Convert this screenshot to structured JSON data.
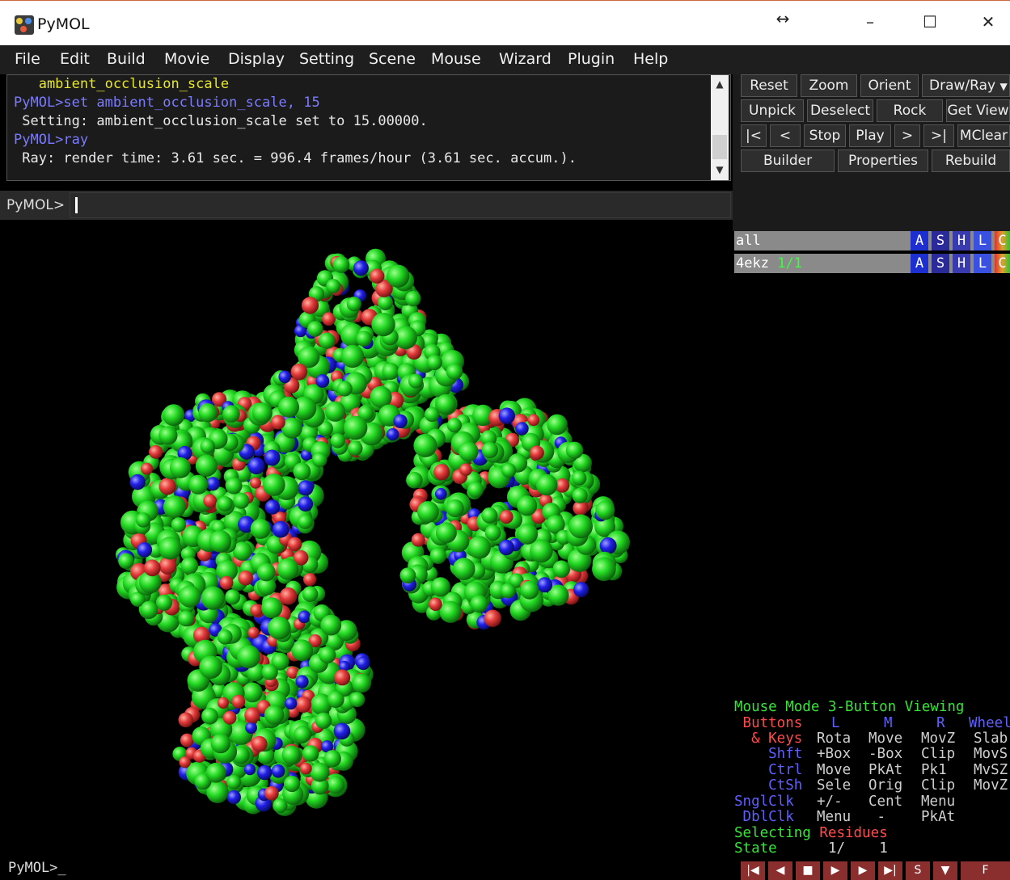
{
  "window": {
    "title": "PyMOL",
    "resize_icon": "↔",
    "minimize": "–",
    "maximize": "☐",
    "close": "✕"
  },
  "menu": [
    "File",
    "Edit",
    "Build",
    "Movie",
    "Display",
    "Setting",
    "Scene",
    "Mouse",
    "Wizard",
    "Plugin",
    "Help"
  ],
  "console": {
    "lines": [
      {
        "text": "   ambient_occlusion_scale",
        "color": "#e6e62e"
      },
      {
        "text": "PyMOL>set ambient_occlusion_scale, 15",
        "color": "#7b7bff"
      },
      {
        "text": " Setting: ambient_occlusion_scale set to 15.00000.",
        "color": "#e8e8e8"
      },
      {
        "text": "PyMOL>ray",
        "color": "#7b7bff"
      },
      {
        "text": " Ray: render time: 3.61 sec. = 996.4 frames/hour (3.61 sec. accum.).",
        "color": "#e8e8e8"
      }
    ]
  },
  "command": {
    "prompt": "PyMOL>",
    "value": ""
  },
  "buttons": {
    "row1": [
      "Reset",
      "Zoom",
      "Orient",
      "Draw/Ray"
    ],
    "row2": [
      "Unpick",
      "Deselect",
      "Rock",
      "Get View"
    ],
    "row3": [
      "|<",
      "<",
      "Stop",
      "Play",
      ">",
      ">|",
      "MClear"
    ],
    "row4": [
      "Builder",
      "Properties",
      "Rebuild"
    ]
  },
  "objects": [
    {
      "name": "all",
      "state": ""
    },
    {
      "name": "4ekz",
      "state": "1/1"
    }
  ],
  "object_buttons": [
    "A",
    "S",
    "H",
    "L",
    "C"
  ],
  "mouse_panel": {
    "mode": "Mouse Mode 3-Button Viewing",
    "buttons_header": {
      "label": " Buttons",
      "l": "L",
      "m": "M",
      "r": "R",
      "wheel": "Wheel"
    },
    "keys_row": {
      "label": "  & Keys",
      "l": "Rota",
      "m": "Move",
      "r": "MovZ",
      "wheel": "Slab"
    },
    "shft_row": {
      "label": "    Shft",
      "l": "+Box",
      "m": "-Box",
      "r": "Clip",
      "wheel": "MovS"
    },
    "ctrl_row": {
      "label": "    Ctrl",
      "l": "Move",
      "m": "PkAt",
      "r": "Pk1",
      "wheel": "MvSZ"
    },
    "ctsh_row": {
      "label": "    CtSh",
      "l": "Sele",
      "m": "Orig",
      "r": "Clip",
      "wheel": "MovZ"
    },
    "sngl_row": {
      "label": "SnglClk",
      "l": "+/-",
      "m": "Cent",
      "r": "Menu"
    },
    "dbl_row": {
      "label": " DblClk",
      "l": "Menu",
      "m": " - ",
      "r": "PkAt"
    },
    "selecting": "Selecting",
    "selecting_value": "Residues",
    "state_label": "State",
    "state_value": "1/    1"
  },
  "transport": [
    "|◀",
    "◀",
    "■",
    "▶",
    "▶",
    "▶|",
    "S",
    "▼",
    "F"
  ],
  "bottom_prompt": "PyMOL>_",
  "colors": {
    "carbon": "#22d922",
    "oxygen": "#e43b3b",
    "nitrogen": "#2020e8",
    "background": "#000000"
  }
}
